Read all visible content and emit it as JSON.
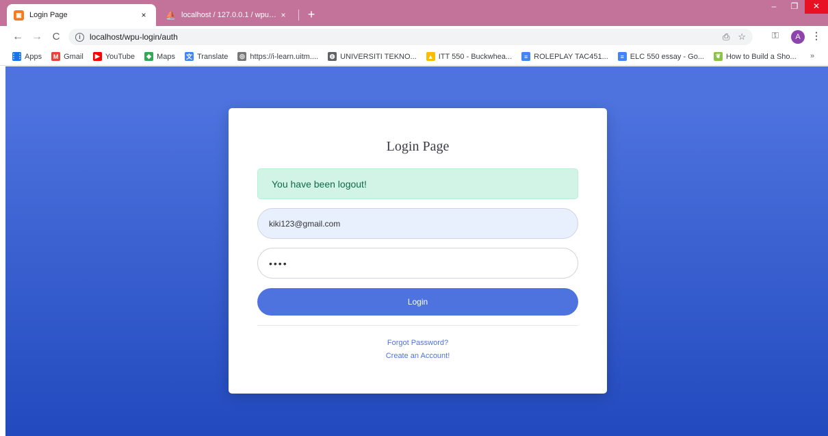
{
  "browser": {
    "tabs": [
      {
        "title": "Login Page",
        "favicon": "login-favicon",
        "active": true
      },
      {
        "title": "localhost / 127.0.0.1 / wpu_login",
        "favicon": "phpmyadmin-favicon",
        "active": false
      }
    ],
    "tab_close": "×",
    "new_tab": "+",
    "window_controls": {
      "minimize": "–",
      "maximize": "❐",
      "close": "✕"
    },
    "url": "localhost/wpu-login/auth",
    "nav": {
      "back": "←",
      "forward": "→",
      "reload": "C"
    },
    "avatar_initial": "A",
    "bookmarks": [
      {
        "label": "Apps",
        "icon": "apps-grid-icon",
        "color": "#1a73e8"
      },
      {
        "label": "Gmail",
        "icon": "gmail-icon",
        "color": "#ea4335"
      },
      {
        "label": "YouTube",
        "icon": "youtube-icon",
        "color": "#ff0000"
      },
      {
        "label": "Maps",
        "icon": "maps-icon",
        "color": "#34a853"
      },
      {
        "label": "Translate",
        "icon": "translate-icon",
        "color": "#4285f4"
      },
      {
        "label": "https://i-learn.uitm....",
        "icon": "ilearn-icon",
        "color": "#777777"
      },
      {
        "label": "UNIVERSITI TEKNO...",
        "icon": "globe-icon",
        "color": "#5f6368"
      },
      {
        "label": "ITT 550 - Buckwhea...",
        "icon": "drive-icon",
        "color": "#fbbc04"
      },
      {
        "label": "ROLEPLAY TAC451...",
        "icon": "docs-icon",
        "color": "#4285f4"
      },
      {
        "label": "ELC 550 essay - Go...",
        "icon": "docs-icon",
        "color": "#4285f4"
      },
      {
        "label": "How to Build a Sho...",
        "icon": "leaf-icon",
        "color": "#8bc34a"
      }
    ],
    "bookmarks_more": "»"
  },
  "page": {
    "title": "Login Page",
    "alert": "You have been logout!",
    "email_value": "kiki123@gmail.com",
    "password_value": "••••",
    "login_button": "Login",
    "forgot_link": "Forgot Password?",
    "create_link": "Create an Account!"
  },
  "colors": {
    "primary": "#4e73df",
    "gradient_end": "#224abe",
    "tabstrip": "#c3729a",
    "alert_bg": "#d1f4e7"
  }
}
